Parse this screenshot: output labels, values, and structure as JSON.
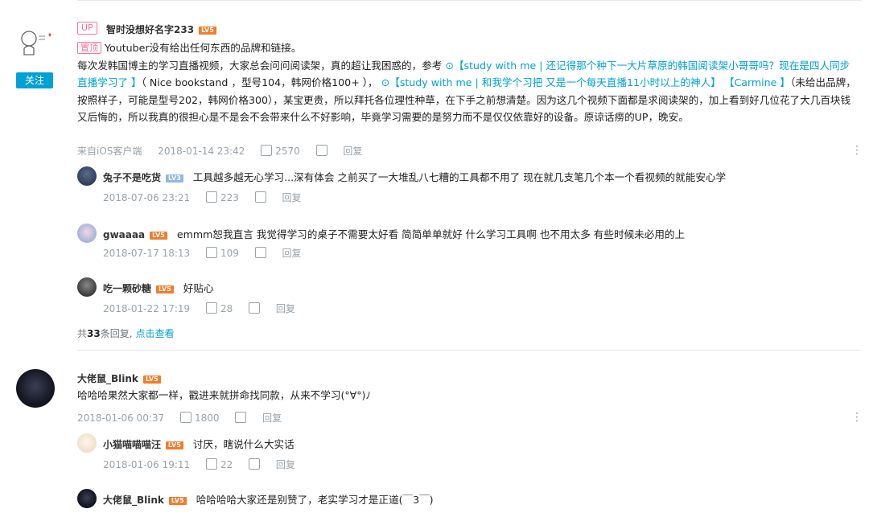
{
  "comment1": {
    "badge": "UP",
    "username": "智时没想好名字233",
    "level": "LV5",
    "follow_label": "关注",
    "pinned_tag": "置顶",
    "text_first": "Youtuber没有给出任何东西的品牌和链接。",
    "text_a": "每次发韩国博主的学习直播视频，大家总会问问阅读架，真的超让我困惑的，参考",
    "link1": "【study with me | 还记得那个种下一大片草原的韩国阅读架小哥哥吗？现在是四人同步直播学习了 】",
    "text_b": "（ Nice bookstand ，型号104，韩网价格100+ ），",
    "link2": "【study with me | 和我学个习把 又是一个每天直播11小时以上的神人】",
    "link3": "【Carmine 】",
    "text_c": "（未给出品牌，按照样子，可能是型号202，韩网价格300），某宝更贵，所以拜托各位理性种草，在下手之前想清楚。因为这几个视频下面都是求阅读架的，加上看到好几位花了大几百块钱又后悔的，所以我真的很担心是不是会不会带来什么不好影响，毕竟学习需要的是努力而不是仅仅依靠好的设备。原谅话痨的UP，晚安。",
    "source": "来自iOS客户端",
    "time": "2018-01-14 23:42",
    "likes": "2570",
    "reply_label": "回复",
    "replies": [
      {
        "name": "兔子不是吃货",
        "level": "LV3",
        "text": "工具越多越无心学习...深有体会 之前买了一大堆乱八七糟的工具都不用了  现在就几支笔几个本一个看视频的就能安心学",
        "time": "2018-07-06 23:21",
        "likes": "223",
        "reply": "回复"
      },
      {
        "name": "gwaaaa",
        "level": "LV5",
        "text": "emmm恕我直言 我觉得学习的桌子不需要太好看 简简单单就好 什么学习工具啊 也不用太多 有些时候未必用的上",
        "time": "2018-07-17 18:13",
        "likes": "109",
        "reply": "回复"
      },
      {
        "name": "吃一颗砂糖",
        "level": "LV5",
        "text": "好贴心",
        "time": "2018-01-22 17:19",
        "likes": "28",
        "reply": "回复"
      }
    ],
    "total_prefix": "共",
    "total_count": "33",
    "total_suffix": "条回复,",
    "view_all": "点击查看"
  },
  "comment2": {
    "username": "大佬鼠_Blink",
    "level": "LV5",
    "text": "哈哈哈果然大家都一样，戳进来就拼命找同款，从来不学习(°∀°)ﾉ",
    "time": "2018-01-06 00:37",
    "likes": "1800",
    "reply_label": "回复",
    "replies": [
      {
        "name": "小猫喵喵喵汪",
        "level": "LV5",
        "text": "讨厌，瞎说什么大实话",
        "time": "2018-01-06 19:11",
        "likes": "22",
        "reply": "回复"
      },
      {
        "name": "大佬鼠_Blink",
        "level": "LV5",
        "text": "哈哈哈哈大家还是别赞了，老实学习才是正道(￣3￣)"
      }
    ]
  },
  "colors": {
    "accent": "#00a1d6",
    "pink": "#fb7299",
    "level": "#f37b2a",
    "meta": "#99a2aa"
  }
}
